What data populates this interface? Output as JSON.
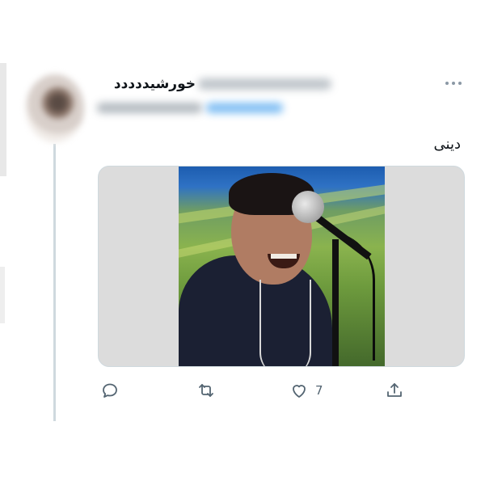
{
  "tweet": {
    "author": {
      "display_name": "خورشیددددد"
    },
    "text": "دینی",
    "actions": {
      "reply_icon": "reply-icon",
      "retweet_icon": "retweet-icon",
      "like_icon": "heart-icon",
      "like_count": "7",
      "share_icon": "share-icon"
    }
  },
  "colors": {
    "icon": "#536471",
    "thread_line": "#cfd9de",
    "text": "#0f1419"
  }
}
